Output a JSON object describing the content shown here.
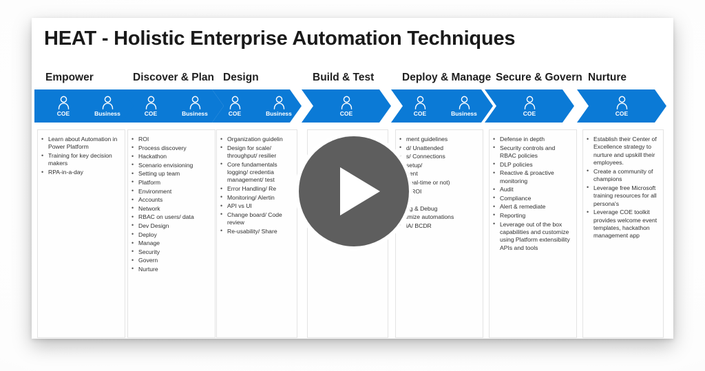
{
  "slide": {
    "title": "HEAT - Holistic Enterprise Automation Techniques"
  },
  "theme": {
    "brand_blue": "#0b7ad6",
    "play_button_gray": "#5e5e5e",
    "card_background": "#ffffff",
    "text_color": "#2f2f2f"
  },
  "overlay": {
    "play_button_label": "Play video",
    "play_icon": "play-triangle-icon"
  },
  "phases": [
    {
      "id": "empower",
      "header": "Empower",
      "personas": [
        {
          "label": "COE",
          "icon": "person-icon"
        },
        {
          "label": "Business",
          "icon": "person-icon"
        }
      ],
      "bullets": [
        "Learn about Automation in Power Platform",
        "Training for key decision makers",
        "RPA-in-a-day"
      ]
    },
    {
      "id": "discover-and-plan",
      "header": "Discover & Plan",
      "personas": [
        {
          "label": "COE",
          "icon": "person-icon"
        },
        {
          "label": "Business",
          "icon": "person-icon"
        }
      ],
      "bullets": [
        "ROI",
        "Process discovery",
        "Hackathon",
        "Scenario envisioning",
        "Setting up team",
        "Platform",
        "Environment",
        "Accounts",
        "Network",
        "RBAC on users/ data",
        "Dev Design",
        "Deploy",
        "Manage",
        "Security",
        "Govern",
        "Nurture"
      ]
    },
    {
      "id": "design",
      "header": "Design",
      "personas": [
        {
          "label": "COE",
          "icon": "person-icon"
        },
        {
          "label": "Business",
          "icon": "person-icon"
        }
      ],
      "bullets": [
        "Organization guidelin",
        "Design for scale/ throughput/ resilier",
        "Core fundamentals logging/ credentia management/ test",
        "Error Handling/ Re",
        "Monitoring/ Alertin",
        "API vs UI",
        "Change board/ Code review",
        "Re-usability/ Share"
      ]
    },
    {
      "id": "build-and-test",
      "header": "Build & Test",
      "personas": [
        {
          "label": "COE",
          "icon": "person-icon"
        }
      ],
      "bullets": []
    },
    {
      "id": "deploy-and-manage",
      "header": "Deploy & Manage",
      "personas": [
        {
          "label": "COE",
          "icon": "person-icon"
        },
        {
          "label": "Business",
          "icon": "person-icon"
        }
      ],
      "bullets": [
        "ment guidelines",
        "d/ Unattended",
        "s/ Connections",
        "setup/",
        "nent",
        "(real-time or not)",
        "e ROI",
        "ie",
        "ng & Debug",
        "imize automations",
        "iA/ BCDR"
      ]
    },
    {
      "id": "secure-and-govern",
      "header": "Secure & Govern",
      "personas": [
        {
          "label": "COE",
          "icon": "person-icon"
        }
      ],
      "bullets": [
        "Defense in depth",
        "Security controls and RBAC policies",
        "DLP policies",
        "Reactive & proactive monitoring",
        "Audit",
        "Compliance",
        "Alert & remediate",
        "Reporting",
        "Leverage out of the box capabilities and customize using Platform extensibility APIs and tools"
      ]
    },
    {
      "id": "nurture",
      "header": "Nurture",
      "personas": [
        {
          "label": "COE",
          "icon": "person-icon"
        }
      ],
      "bullets": [
        "Establish their Center of Excellence strategy to nurture and upskill their employees.",
        "Create a community of champions",
        "Leverage free Microsoft training resources for all persona's",
        "Leverage COE toolkit provides welcome event templates, hackathon management app"
      ]
    }
  ]
}
